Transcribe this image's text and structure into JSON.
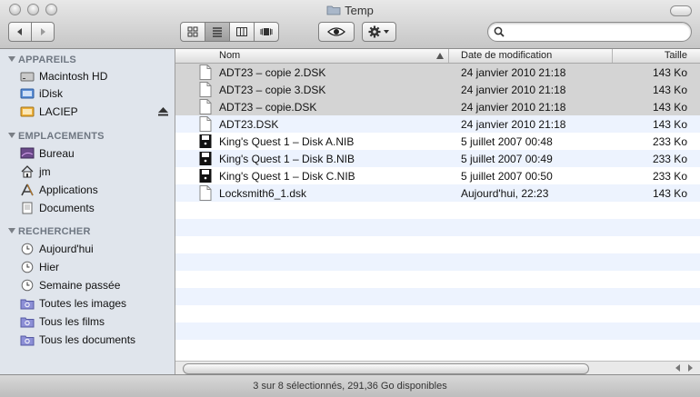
{
  "window": {
    "title": "Temp"
  },
  "toolbar": {
    "back_icon": "back-arrow-icon",
    "forward_icon": "forward-arrow-icon",
    "view_modes": [
      "icons",
      "list",
      "columns",
      "coverflow"
    ],
    "selected_view": "list",
    "search": {
      "value": "",
      "placeholder": ""
    }
  },
  "sidebar": {
    "sections": [
      {
        "title": "APPAREILS",
        "items": [
          {
            "label": "Macintosh HD",
            "icon": "hard-disk-icon"
          },
          {
            "label": "iDisk",
            "icon": "idisk-icon"
          },
          {
            "label": "LACIEP",
            "icon": "external-disk-icon",
            "eject": true
          }
        ]
      },
      {
        "title": "EMPLACEMENTS",
        "items": [
          {
            "label": "Bureau",
            "icon": "desktop-icon"
          },
          {
            "label": "jm",
            "icon": "home-icon"
          },
          {
            "label": "Applications",
            "icon": "applications-icon"
          },
          {
            "label": "Documents",
            "icon": "documents-icon"
          }
        ]
      },
      {
        "title": "RECHERCHER",
        "items": [
          {
            "label": "Aujourd'hui",
            "icon": "clock-icon"
          },
          {
            "label": "Hier",
            "icon": "clock-icon"
          },
          {
            "label": "Semaine passée",
            "icon": "clock-icon"
          },
          {
            "label": "Toutes les images",
            "icon": "smart-folder-icon"
          },
          {
            "label": "Tous les films",
            "icon": "smart-folder-icon"
          },
          {
            "label": "Tous les documents",
            "icon": "smart-folder-icon"
          }
        ]
      }
    ]
  },
  "columns": {
    "name": "Nom",
    "date": "Date de modification",
    "size": "Taille"
  },
  "files": [
    {
      "name": "ADT23 – copie 2.DSK",
      "date": "24 janvier 2010 21:18",
      "size": "143 Ko",
      "icon": "document-icon",
      "selected": true
    },
    {
      "name": "ADT23 – copie 3.DSK",
      "date": "24 janvier 2010 21:18",
      "size": "143 Ko",
      "icon": "document-icon",
      "selected": true
    },
    {
      "name": "ADT23 – copie.DSK",
      "date": "24 janvier 2010 21:18",
      "size": "143 Ko",
      "icon": "document-icon",
      "selected": true
    },
    {
      "name": "ADT23.DSK",
      "date": "24 janvier 2010 21:18",
      "size": "143 Ko",
      "icon": "document-icon",
      "selected": false
    },
    {
      "name": "King's Quest 1 – Disk A.NIB",
      "date": "5 juillet 2007 00:48",
      "size": "233 Ko",
      "icon": "floppy-disk-icon",
      "selected": false
    },
    {
      "name": "King's Quest 1 – Disk B.NIB",
      "date": "5 juillet 2007 00:49",
      "size": "233 Ko",
      "icon": "floppy-disk-icon",
      "selected": false
    },
    {
      "name": "King's Quest 1 – Disk C.NIB",
      "date": "5 juillet 2007 00:50",
      "size": "233 Ko",
      "icon": "floppy-disk-icon",
      "selected": false
    },
    {
      "name": "Locksmith6_1.dsk",
      "date": "Aujourd'hui, 22:23",
      "size": "143 Ko",
      "icon": "document-icon",
      "selected": false
    }
  ],
  "status": {
    "text": "3 sur 8 sélectionnés, 291,36 Go disponibles"
  },
  "colors": {
    "sidebar_bg": "#e0e5ec",
    "row_alt": "#edf3fe",
    "selection": "#d4d4d4"
  }
}
